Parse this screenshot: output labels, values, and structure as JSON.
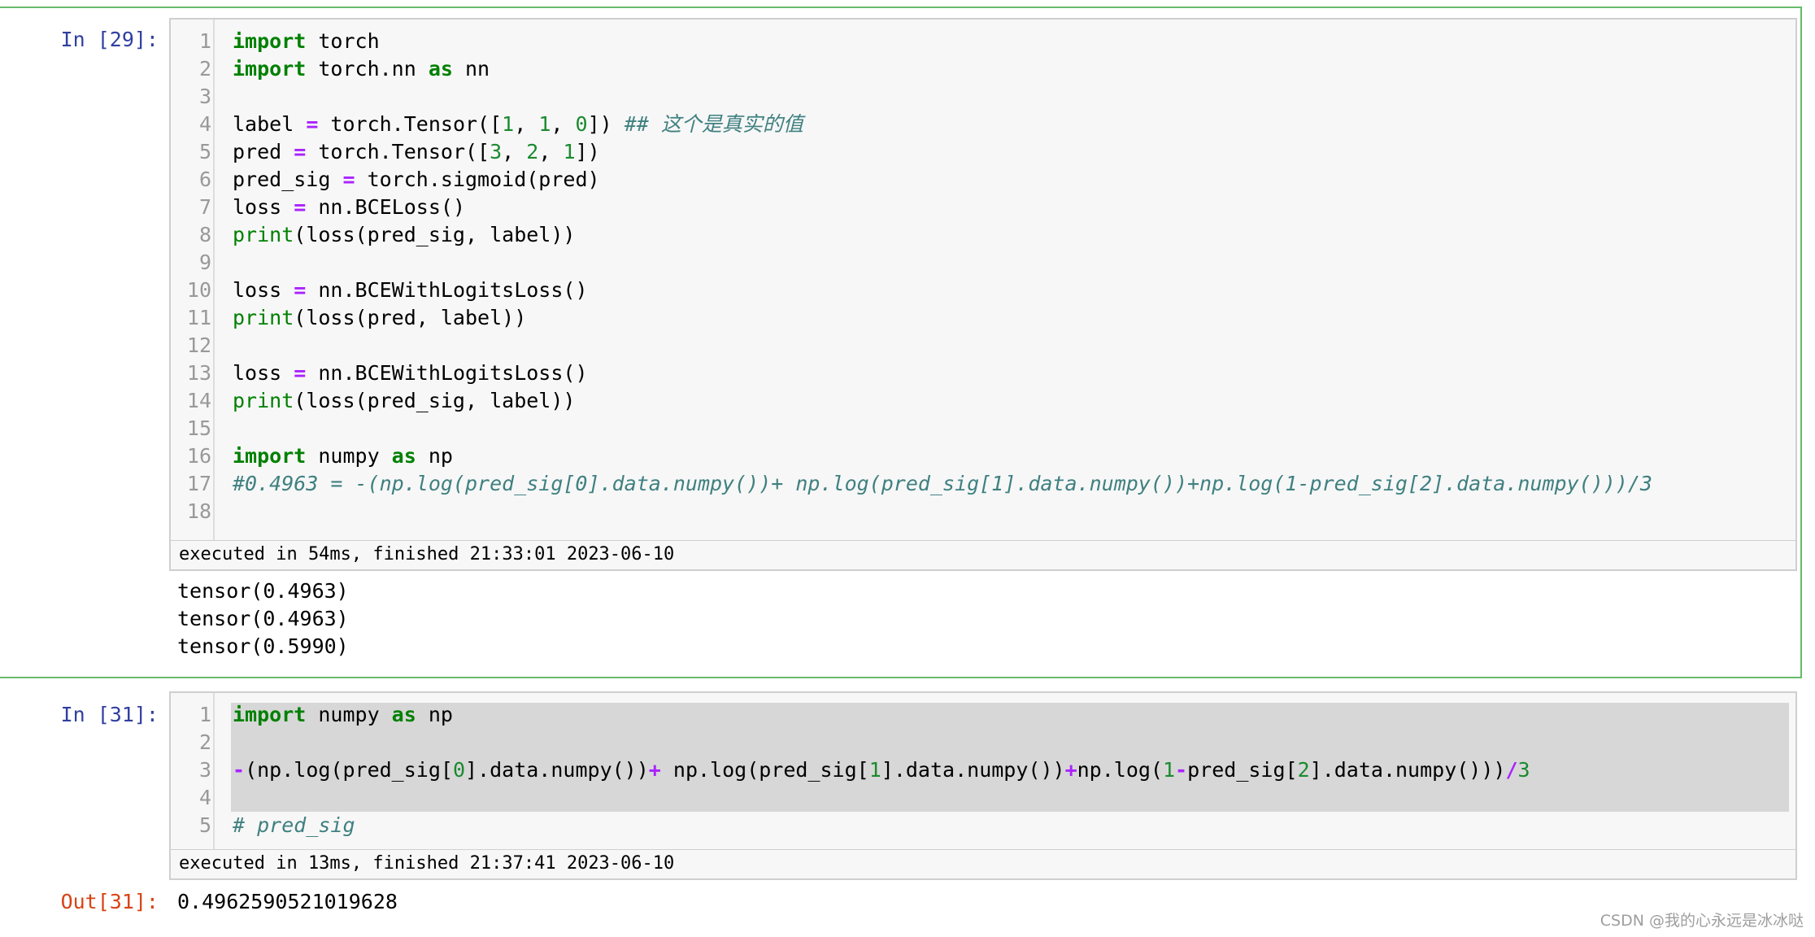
{
  "cell1": {
    "prompt": "In [29]:",
    "lines": [
      {
        "n": "1",
        "segs": [
          [
            "kw",
            "import"
          ],
          [
            "",
            "torch"
          ]
        ]
      },
      {
        "n": "2",
        "segs": [
          [
            "kw",
            "import"
          ],
          [
            "",
            "torch.nn"
          ],
          [
            "kw",
            "as"
          ],
          [
            "",
            "nn"
          ]
        ]
      },
      {
        "n": "3",
        "segs": []
      },
      {
        "n": "4",
        "segs": [
          [
            "",
            "label "
          ],
          [
            "op",
            "="
          ],
          [
            "",
            " torch.Tensor(["
          ],
          [
            "nm",
            "1"
          ],
          [
            "",
            ", "
          ],
          [
            "nm",
            "1"
          ],
          [
            "",
            ", "
          ],
          [
            "nm",
            "0"
          ],
          [
            "",
            "]) "
          ],
          [
            "cm",
            "## 这个是真实的值"
          ]
        ]
      },
      {
        "n": "5",
        "segs": [
          [
            "",
            "pred "
          ],
          [
            "op",
            "="
          ],
          [
            "",
            " torch.Tensor(["
          ],
          [
            "nm",
            "3"
          ],
          [
            "",
            ", "
          ],
          [
            "nm",
            "2"
          ],
          [
            "",
            ", "
          ],
          [
            "nm",
            "1"
          ],
          [
            "",
            "])"
          ]
        ]
      },
      {
        "n": "6",
        "segs": [
          [
            "",
            "pred_sig "
          ],
          [
            "op",
            "="
          ],
          [
            "",
            " torch.sigmoid(pred)"
          ]
        ]
      },
      {
        "n": "7",
        "segs": [
          [
            "",
            "loss "
          ],
          [
            "op",
            "="
          ],
          [
            "",
            " nn.BCELoss()"
          ]
        ]
      },
      {
        "n": "8",
        "segs": [
          [
            "bi",
            "print"
          ],
          [
            "",
            "(loss(pred_sig, label))"
          ]
        ]
      },
      {
        "n": "9",
        "segs": []
      },
      {
        "n": "10",
        "segs": [
          [
            "",
            "loss "
          ],
          [
            "op",
            "="
          ],
          [
            "",
            " nn.BCEWithLogitsLoss()"
          ]
        ]
      },
      {
        "n": "11",
        "segs": [
          [
            "bi",
            "print"
          ],
          [
            "",
            "(loss(pred, label))"
          ]
        ]
      },
      {
        "n": "12",
        "segs": []
      },
      {
        "n": "13",
        "segs": [
          [
            "",
            "loss "
          ],
          [
            "op",
            "="
          ],
          [
            "",
            " nn.BCEWithLogitsLoss()"
          ]
        ]
      },
      {
        "n": "14",
        "segs": [
          [
            "bi",
            "print"
          ],
          [
            "",
            "(loss(pred_sig, label))"
          ]
        ]
      },
      {
        "n": "15",
        "segs": []
      },
      {
        "n": "16",
        "segs": [
          [
            "kw",
            "import"
          ],
          [
            "",
            "numpy"
          ],
          [
            "kw",
            "as"
          ],
          [
            "",
            "np"
          ]
        ]
      },
      {
        "n": "17",
        "segs": [
          [
            "cm",
            "#0.4963 = -(np.log(pred_sig[0].data.numpy())+ np.log(pred_sig[1].data.numpy())+np.log(1-pred_sig[2].data.numpy()))/3"
          ]
        ]
      },
      {
        "n": "18",
        "segs": []
      }
    ],
    "timing": "executed in 54ms, finished 21:33:01 2023-06-10",
    "outputs": [
      "tensor(0.4963)",
      "tensor(0.4963)",
      "tensor(0.5990)"
    ]
  },
  "cell2": {
    "prompt": "In [31]:",
    "lines": [
      {
        "n": "1",
        "segs": [
          [
            "kw",
            "import"
          ],
          [
            "",
            "numpy"
          ],
          [
            "kw",
            "as"
          ],
          [
            "",
            "np"
          ]
        ]
      },
      {
        "n": "2",
        "segs": []
      },
      {
        "n": "3",
        "segs": [
          [
            "op",
            "-"
          ],
          [
            "",
            "(np.log(pred_sig["
          ],
          [
            "nm",
            "0"
          ],
          [
            "",
            "].data.numpy())"
          ],
          [
            "op",
            "+"
          ],
          [
            "",
            " np.log(pred_sig["
          ],
          [
            "nm",
            "1"
          ],
          [
            "",
            "].data.numpy())"
          ],
          [
            "op",
            "+"
          ],
          [
            "",
            "np.log("
          ],
          [
            "nm",
            "1"
          ],
          [
            "op",
            "-"
          ],
          [
            "",
            "pred_sig["
          ],
          [
            "nm",
            "2"
          ],
          [
            "",
            "].data.numpy()))"
          ],
          [
            "op",
            "/"
          ],
          [
            "nm",
            "3"
          ]
        ]
      },
      {
        "n": "4",
        "segs": []
      },
      {
        "n": "5",
        "segs": [
          [
            "cm",
            "# pred_sig"
          ]
        ]
      }
    ],
    "timing": "executed in 13ms, finished 21:37:41 2023-06-10",
    "out_prompt": "Out[31]:",
    "output": "0.4962590521019628"
  },
  "watermark": "CSDN @我的心永远是冰冰哒"
}
